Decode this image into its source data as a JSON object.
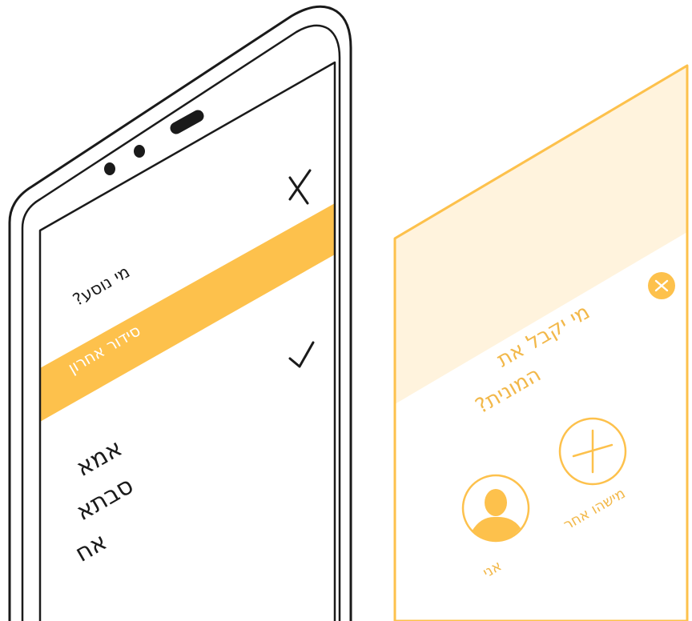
{
  "phone_screen": {
    "question": "מי נוסע?",
    "selected_option": "סידור אחרון",
    "passengers": [
      "אמא",
      "סבתא",
      "אח"
    ]
  },
  "taxi_card": {
    "title_line1": "מי יקבל את",
    "title_line2": "המונית?",
    "option_other": "מישהו אחר",
    "option_me": "אני"
  },
  "icons": {
    "close": "close-icon",
    "check": "check-icon",
    "card_close": "close-circle-icon",
    "plus": "plus-circle-icon",
    "avatar": "person-avatar-icon"
  },
  "colors": {
    "accent": "#FDC14C",
    "accent_light": "#FFF3DD",
    "accent_text": "#F2B84A",
    "outline": "#1A1A1A",
    "white": "#FFFFFF"
  }
}
